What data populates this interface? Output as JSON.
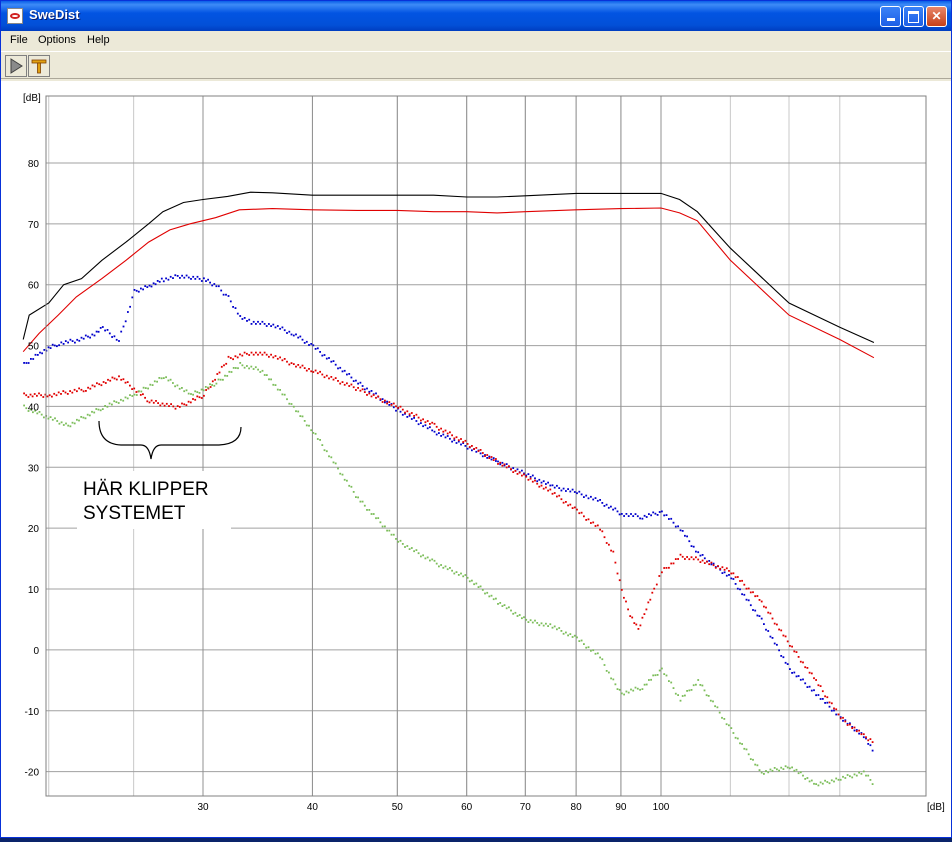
{
  "window": {
    "title": "SweDist",
    "icons": {
      "app": "swedist-app-icon",
      "minimize": "minimize-icon",
      "maximize": "maximize-icon",
      "close": "close-icon"
    }
  },
  "menu": [
    {
      "label": "File"
    },
    {
      "label": "Options"
    },
    {
      "label": "Help"
    }
  ],
  "toolbar": {
    "buttons": [
      {
        "icon": "play-icon"
      },
      {
        "icon": "tuning-fork-icon"
      }
    ]
  },
  "annotation": {
    "line1": "HÄR KLIPPER",
    "line2": "SYSTEMET"
  },
  "colors": {
    "total": "#000000",
    "fundamental": "#e00000",
    "h2": "#0000cc",
    "h3": "#1010d0",
    "h3b": "#70b050",
    "green": "#7cbd5a"
  },
  "chart_data": {
    "type": "line",
    "y_unit_label": "[dB]",
    "x_unit_label": "[dB]",
    "ylim": [
      -24,
      91
    ],
    "y_ticks": [
      80,
      70,
      60,
      50,
      40,
      30,
      20,
      10,
      0,
      -10,
      -20
    ],
    "x_ticks": [
      30,
      40,
      50,
      60,
      70,
      80,
      90,
      100
    ],
    "grid": true,
    "series": [
      {
        "color": "#000000",
        "style": "line",
        "points": [
          [
            18.7,
            51
          ],
          [
            19,
            55
          ],
          [
            20,
            57
          ],
          [
            20.8,
            60
          ],
          [
            21.8,
            61
          ],
          [
            23,
            64
          ],
          [
            24.5,
            67
          ],
          [
            26,
            70
          ],
          [
            27,
            72
          ],
          [
            28.5,
            73.5
          ],
          [
            30,
            74
          ],
          [
            32,
            74.5
          ],
          [
            34,
            75.2
          ],
          [
            36,
            75.1
          ],
          [
            40,
            74.7
          ],
          [
            45,
            74.7
          ],
          [
            50,
            74.7
          ],
          [
            55,
            74.7
          ],
          [
            60,
            74.4
          ],
          [
            65,
            74.4
          ],
          [
            70,
            74.6
          ],
          [
            80,
            75
          ],
          [
            90,
            75
          ],
          [
            100,
            75
          ],
          [
            105,
            74
          ],
          [
            110,
            72
          ],
          [
            120,
            66
          ],
          [
            140,
            57
          ],
          [
            160,
            53
          ],
          [
            175,
            50.5
          ]
        ]
      },
      {
        "color": "#e00000",
        "style": "line",
        "points": [
          [
            18.7,
            49
          ],
          [
            19.5,
            52
          ],
          [
            20.5,
            55
          ],
          [
            21.5,
            58
          ],
          [
            23,
            61
          ],
          [
            24.5,
            64
          ],
          [
            26,
            67
          ],
          [
            27.5,
            69
          ],
          [
            29,
            70
          ],
          [
            31,
            71
          ],
          [
            33,
            72.3
          ],
          [
            36,
            72.5
          ],
          [
            40,
            72.3
          ],
          [
            45,
            72.2
          ],
          [
            50,
            72.2
          ],
          [
            55,
            72
          ],
          [
            60,
            72
          ],
          [
            65,
            71.8
          ],
          [
            70,
            72
          ],
          [
            80,
            72.3
          ],
          [
            90,
            72.5
          ],
          [
            100,
            72.6
          ],
          [
            105,
            71.8
          ],
          [
            110,
            70.5
          ],
          [
            120,
            64
          ],
          [
            140,
            55
          ],
          [
            160,
            51
          ],
          [
            175,
            48
          ]
        ]
      },
      {
        "color": "#0000cc",
        "style": "dots",
        "points": [
          [
            18.7,
            47
          ],
          [
            19.5,
            49
          ],
          [
            20.5,
            50.5
          ],
          [
            21.5,
            51
          ],
          [
            22.5,
            52
          ],
          [
            23,
            53
          ],
          [
            24,
            51
          ],
          [
            25,
            59
          ],
          [
            26,
            60
          ],
          [
            27,
            61
          ],
          [
            28,
            61.5
          ],
          [
            29,
            61.3
          ],
          [
            30,
            61
          ],
          [
            31,
            60
          ],
          [
            32,
            58
          ],
          [
            33,
            55
          ],
          [
            34,
            54
          ],
          [
            36,
            53.5
          ],
          [
            38,
            52
          ],
          [
            40,
            50
          ],
          [
            45,
            44
          ],
          [
            50,
            39.5
          ],
          [
            55,
            36
          ],
          [
            60,
            33.5
          ],
          [
            65,
            31
          ],
          [
            70,
            29
          ],
          [
            75,
            27
          ],
          [
            80,
            26
          ],
          [
            85,
            24.5
          ],
          [
            90,
            22.5
          ],
          [
            95,
            22
          ],
          [
            100,
            22.8
          ],
          [
            105,
            20
          ],
          [
            110,
            16
          ],
          [
            120,
            12
          ],
          [
            130,
            5
          ],
          [
            140,
            -3
          ],
          [
            150,
            -7
          ],
          [
            160,
            -11
          ],
          [
            170,
            -14
          ],
          [
            175,
            -17
          ]
        ]
      },
      {
        "color": "#e00000",
        "style": "dots",
        "points": [
          [
            18.7,
            42
          ],
          [
            20,
            42
          ],
          [
            22,
            43
          ],
          [
            24,
            45
          ],
          [
            26,
            41
          ],
          [
            28,
            40
          ],
          [
            30,
            42
          ],
          [
            32,
            48
          ],
          [
            34,
            49
          ],
          [
            36,
            48.5
          ],
          [
            38,
            47
          ],
          [
            40,
            46
          ],
          [
            45,
            43
          ],
          [
            50,
            40
          ],
          [
            55,
            37
          ],
          [
            60,
            34
          ],
          [
            65,
            31
          ],
          [
            70,
            28.5
          ],
          [
            75,
            26
          ],
          [
            80,
            23
          ],
          [
            85,
            20
          ],
          [
            88,
            16
          ],
          [
            90,
            10
          ],
          [
            92,
            6
          ],
          [
            94,
            3.5
          ],
          [
            96,
            7
          ],
          [
            98,
            10
          ],
          [
            100,
            13
          ],
          [
            105,
            15.5
          ],
          [
            110,
            15
          ],
          [
            120,
            13
          ],
          [
            130,
            8
          ],
          [
            140,
            1
          ],
          [
            150,
            -5
          ],
          [
            160,
            -11
          ],
          [
            170,
            -14
          ],
          [
            175,
            -15
          ]
        ]
      },
      {
        "color": "#7cbd5a",
        "style": "dots",
        "points": [
          [
            18.7,
            40
          ],
          [
            21,
            37
          ],
          [
            23,
            40
          ],
          [
            25,
            42
          ],
          [
            27,
            45
          ],
          [
            29,
            42
          ],
          [
            31,
            44
          ],
          [
            33,
            47
          ],
          [
            35,
            46
          ],
          [
            36,
            44
          ],
          [
            38,
            40
          ],
          [
            40,
            36
          ],
          [
            45,
            25
          ],
          [
            50,
            18
          ],
          [
            55,
            14.5
          ],
          [
            60,
            12
          ],
          [
            65,
            8
          ],
          [
            70,
            5
          ],
          [
            75,
            4
          ],
          [
            80,
            2
          ],
          [
            85,
            -1
          ],
          [
            88,
            -5
          ],
          [
            90,
            -7
          ],
          [
            95,
            -6
          ],
          [
            100,
            -3
          ],
          [
            105,
            -8
          ],
          [
            110,
            -5
          ],
          [
            115,
            -9
          ],
          [
            120,
            -13
          ],
          [
            130,
            -20
          ],
          [
            140,
            -19
          ],
          [
            150,
            -22
          ],
          [
            160,
            -21
          ],
          [
            170,
            -20
          ],
          [
            175,
            -22
          ]
        ]
      }
    ]
  }
}
